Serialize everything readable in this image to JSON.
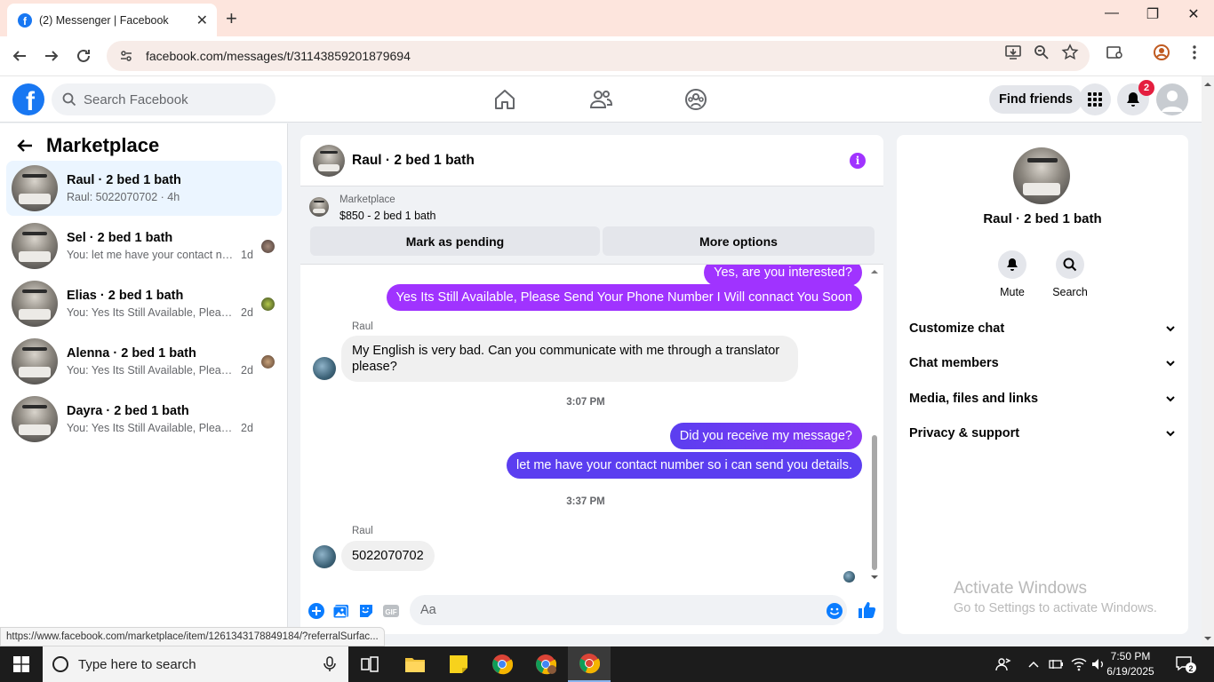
{
  "browser": {
    "tab_title": "(2) Messenger | Facebook",
    "url": "facebook.com/messages/t/31143859201879694",
    "status_url": "https://www.facebook.com/marketplace/item/1261343178849184/?referralSurfac..."
  },
  "fb_header": {
    "search_placeholder": "Search Facebook",
    "find_friends": "Find friends",
    "notification_count": "2"
  },
  "sidebar": {
    "title": "Marketplace",
    "conversations": [
      {
        "name": "Raul · 2 bed 1 bath",
        "preview": "Raul: 5022070702 · 4h",
        "time": ""
      },
      {
        "name": "Sel · 2 bed 1 bath",
        "preview": "You: let me have your contact num...",
        "time": "1d"
      },
      {
        "name": "Elias · 2 bed 1 bath",
        "preview": "You: Yes Its Still Available, Please Se...",
        "time": "2d"
      },
      {
        "name": "Alenna · 2 bed 1 bath",
        "preview": "You: Yes Its Still Available, Please Se...",
        "time": "2d"
      },
      {
        "name": "Dayra · 2 bed 1 bath",
        "preview": "You: Yes Its Still Available, Please Send...",
        "time": "2d"
      }
    ]
  },
  "chat": {
    "title": "Raul · 2 bed 1 bath",
    "listing_source": "Marketplace",
    "listing_price": "$850 - 2 bed 1 bath",
    "mark_pending": "Mark as pending",
    "more_options": "More options",
    "messages": {
      "out1": "Yes, are you interested?",
      "out2": "Yes Its Still Available, Please Send Your Phone Number I Will connact You Soon",
      "sender1": "Raul",
      "in1": "My English is very bad. Can you communicate with me through a translator please?",
      "time1": "3:07 PM",
      "out3": "Did you receive my message?",
      "out4": "let me have your contact number so i can send you details.",
      "time2": "3:37 PM",
      "sender2": "Raul",
      "in2": "5022070702"
    },
    "composer_placeholder": "Aa"
  },
  "right_panel": {
    "name": "Raul · 2 bed 1 bath",
    "mute": "Mute",
    "search": "Search",
    "sections": [
      "Customize chat",
      "Chat members",
      "Media, files and links",
      "Privacy & support"
    ],
    "watermark_title": "Activate Windows",
    "watermark_sub": "Go to Settings to activate Windows."
  },
  "taskbar": {
    "search_placeholder": "Type here to search",
    "time": "7:50 PM",
    "date": "6/19/2025",
    "notification_count": "2"
  },
  "colors": {
    "fb_blue": "#1877f2",
    "messenger_purple": "#a033ff",
    "messenger_blue": "#5b3ef0"
  }
}
